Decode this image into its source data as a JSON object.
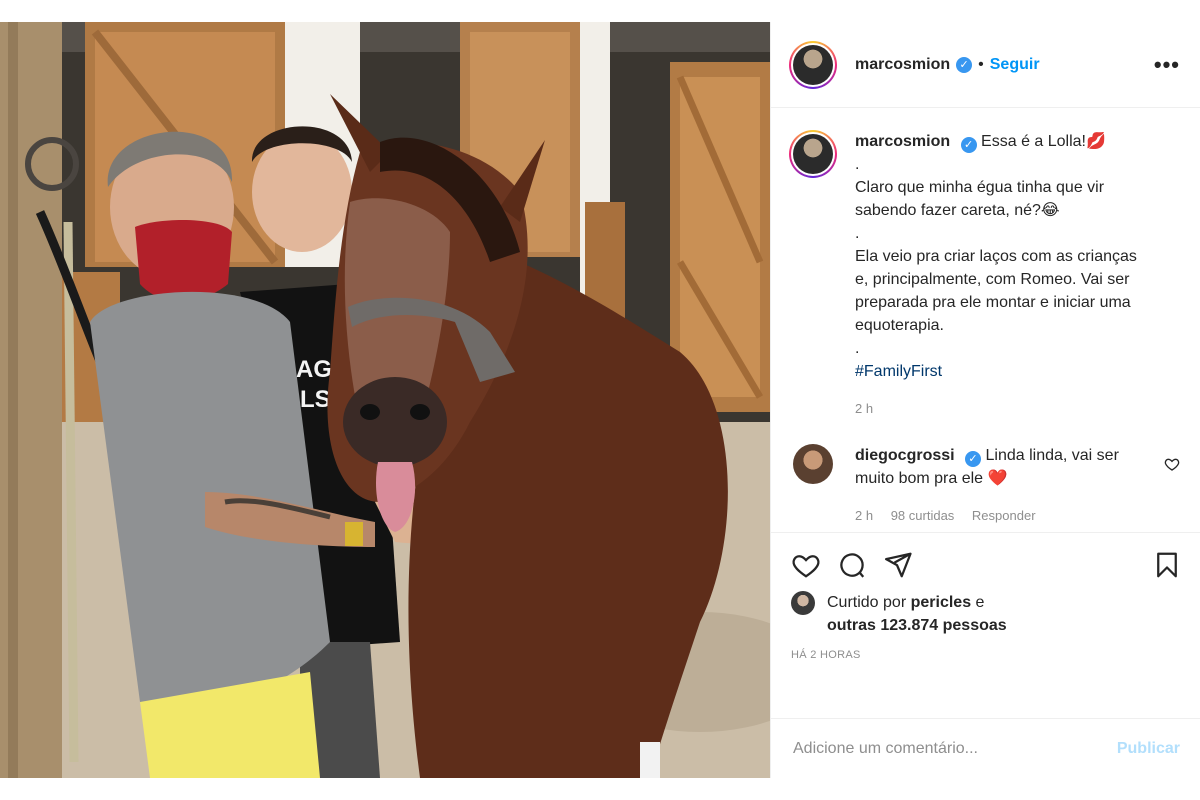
{
  "header": {
    "username": "marcosmion",
    "verified_glyph": "✓",
    "separator": "•",
    "follow_label": "Seguir",
    "more_label": "•••"
  },
  "caption": {
    "username": "marcosmion",
    "lines": [
      "Essa é a Lolla!💋",
      ".",
      "Claro que minha égua tinha que vir sabendo fazer careta, né?😂",
      ".",
      "Ela veio pra criar laços com as crianças e, principalmente, com Romeo. Vai ser preparada pra ele montar e iniciar uma equoterapia.",
      "."
    ],
    "hashtag": "#FamilyFirst",
    "time": "2 h"
  },
  "comment": {
    "username": "diegocgrossi",
    "text": "Linda linda, vai ser muito bom pra ele ❤️",
    "time": "2 h",
    "likes": "98 curtidas",
    "reply_label": "Responder"
  },
  "likes": {
    "prefix": "Curtido por",
    "user": "pericles",
    "conjunction": "e",
    "others": "outras 123.874 pessoas"
  },
  "posted_ago": "HÁ 2 HORAS",
  "add_comment": {
    "placeholder": "Adicione um comentário...",
    "publish_label": "Publicar"
  },
  "icons": {
    "like": "heart-icon",
    "comment": "comment-icon",
    "share": "share-icon",
    "save": "bookmark-icon",
    "options": "more-options-icon",
    "verified": "verified-badge-icon"
  },
  "colors": {
    "accent": "#0095f6",
    "verified": "#3897f0",
    "hashtag": "#00376b",
    "muted": "#8e8e8e",
    "publish_disabled": "#b2dffc"
  }
}
